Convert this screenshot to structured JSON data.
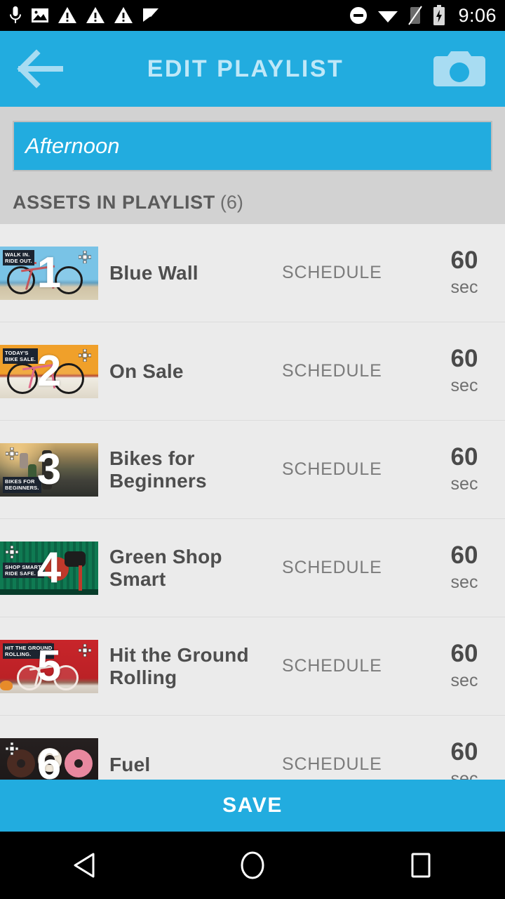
{
  "statusbar": {
    "time": "9:06",
    "left_icons": [
      "microphone-icon",
      "image-icon",
      "warning-triangle-icon",
      "warning-triangle-icon",
      "warning-triangle-icon",
      "flag-check-icon"
    ],
    "right_icons": [
      "do-not-disturb-icon",
      "wifi-icon",
      "no-sim-signal-icon",
      "battery-charging-icon"
    ]
  },
  "appbar": {
    "title": "EDIT PLAYLIST",
    "back_icon": "back-arrow-icon",
    "camera_icon": "camera-icon",
    "background_color": "#22ACDF"
  },
  "playlist": {
    "name_value": "Afternoon",
    "name_placeholder": "Afternoon",
    "section_title": "ASSETS IN PLAYLIST",
    "section_count": "(6)"
  },
  "assets": [
    {
      "index": "1",
      "title": "Blue Wall",
      "schedule_label": "SCHEDULE",
      "duration": "60",
      "duration_unit": "sec",
      "badge_text": "WALK IN.\nRIDE OUT.",
      "badge_pos": "top-left",
      "drag_pos": "top-right",
      "thumb_colors": [
        "#7cc5e8",
        "#a8d8ee",
        "#cfc6ad"
      ]
    },
    {
      "index": "2",
      "title": "On Sale",
      "schedule_label": "SCHEDULE",
      "duration": "60",
      "duration_unit": "sec",
      "badge_text": "TODAY'S\nBIKE SALE.",
      "badge_pos": "top-left",
      "drag_pos": "top-right",
      "thumb_colors": [
        "#f0a02a",
        "#efefe9",
        "#d8d2c6"
      ]
    },
    {
      "index": "3",
      "title": "Bikes for Beginners",
      "schedule_label": "SCHEDULE",
      "duration": "60",
      "duration_unit": "sec",
      "badge_text": "BIKES FOR\nBEGINNERS.",
      "badge_pos": "bottom-left",
      "drag_pos": "top-left",
      "thumb_colors": [
        "#8d7a52",
        "#5b5a46",
        "#3a3b33"
      ]
    },
    {
      "index": "4",
      "title": "Green Shop Smart",
      "schedule_label": "SCHEDULE",
      "duration": "60",
      "duration_unit": "sec",
      "badge_text": "SHOP SMART.\nRIDE SAFE.",
      "badge_pos": "top-left",
      "drag_pos": "top-left",
      "thumb_colors": [
        "#0f7a52",
        "#0b6344",
        "#c0392b"
      ]
    },
    {
      "index": "5",
      "title": "Hit the Ground Rolling",
      "schedule_label": "SCHEDULE",
      "duration": "60",
      "duration_unit": "sec",
      "badge_text": "HIT THE GROUND\nROLLING.",
      "badge_pos": "top-left",
      "drag_pos": "top-right",
      "thumb_colors": [
        "#c8252a",
        "#a81d22",
        "#e4e0da"
      ]
    },
    {
      "index": "6",
      "title": "Fuel",
      "schedule_label": "SCHEDULE",
      "duration": "60",
      "duration_unit": "sec",
      "badge_text": "",
      "badge_pos": "none",
      "drag_pos": "top-left",
      "thumb_colors": [
        "#201c1c",
        "#4a2b22",
        "#e8889f"
      ]
    }
  ],
  "save": {
    "label": "SAVE"
  },
  "navbar": {
    "back_icon": "nav-back-triangle-icon",
    "home_icon": "nav-home-circle-icon",
    "recents_icon": "nav-recents-square-icon"
  }
}
